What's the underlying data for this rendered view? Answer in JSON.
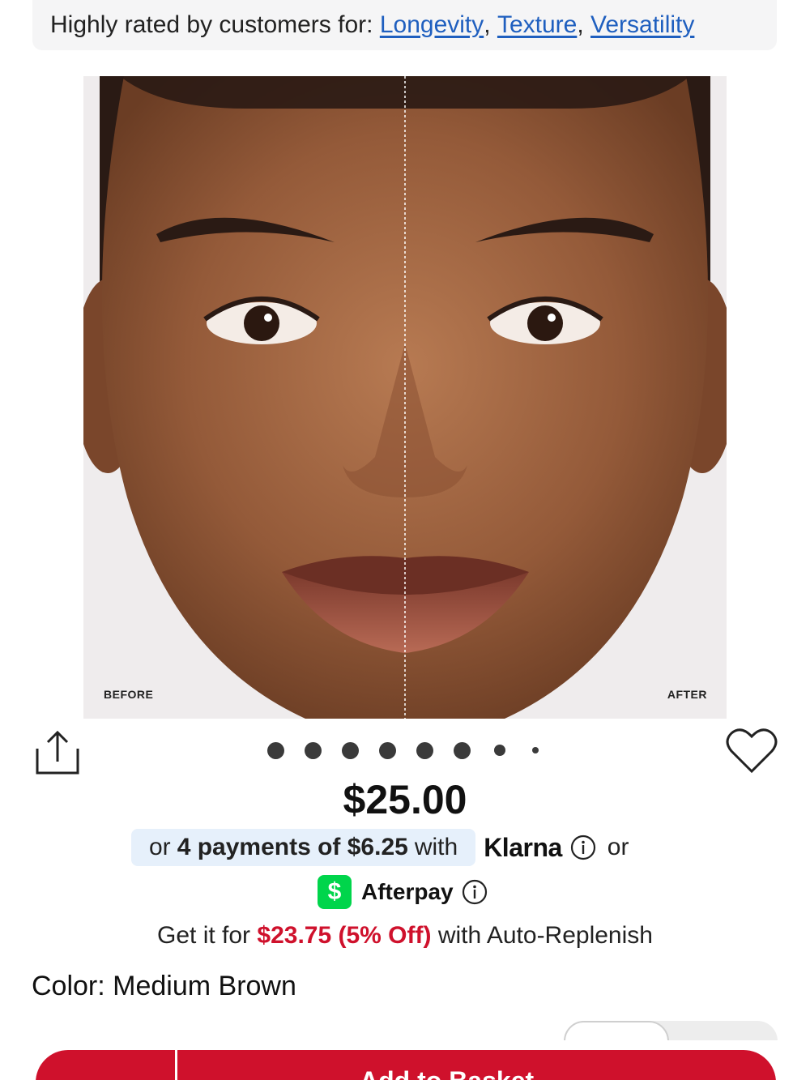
{
  "rated": {
    "prefix": "Highly rated by customers for: ",
    "tags": [
      "Longevity",
      "Texture",
      "Versatility"
    ],
    "separator": ", "
  },
  "image": {
    "before_label": "BEFORE",
    "after_label": "AFTER",
    "carousel_count": 8,
    "active_index": 0
  },
  "actions": {
    "share_icon": "share-icon",
    "favorite_icon": "heart-icon"
  },
  "price": "$25.00",
  "klarna": {
    "prefix": "or",
    "bold": "4 payments of $6.25",
    "suffix": "with",
    "brand": "Klarna",
    "or": "or"
  },
  "afterpay": {
    "logo": "$",
    "brand": "Afterpay"
  },
  "replenish": {
    "prefix": "Get it for ",
    "highlight": "$23.75 (5% Off)",
    "suffix": " with Auto-Replenish"
  },
  "color": {
    "label": "Color: ",
    "value": "Medium Brown"
  },
  "basket": {
    "label": "Add to Basket"
  },
  "colors": {
    "link": "#1f5fbf",
    "brand_red": "#cf112c",
    "klarna_bg": "#e6f0fb",
    "cashapp_green": "#00d54b"
  }
}
